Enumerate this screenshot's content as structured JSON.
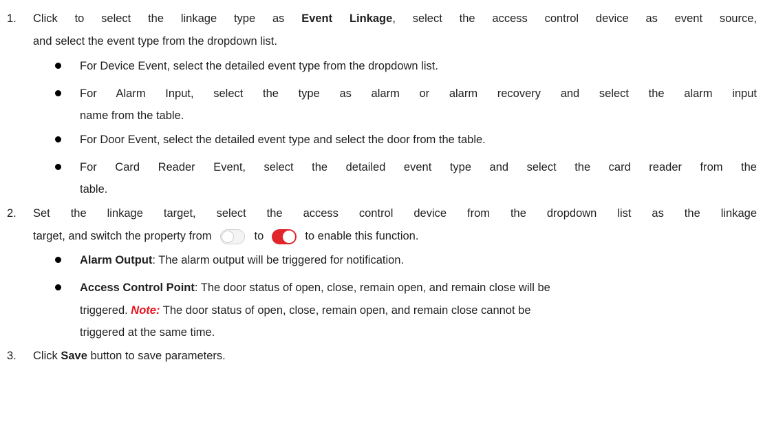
{
  "steps": [
    {
      "number": "1.",
      "lines": [
        {
          "pre": "Click to select the linkage type as ",
          "bold": "Event Linkage",
          "post": ", select the access control device as event source,"
        },
        {
          "text": "and select the event type from the dropdown list."
        }
      ],
      "bullets": [
        {
          "lines": [
            "For Device Event, select the detailed event type from the dropdown list."
          ]
        },
        {
          "lines": [
            "For Alarm Input, select the type as alarm or alarm recovery and select the alarm input",
            "name from the table."
          ]
        },
        {
          "lines": [
            "For Door Event, select the detailed event type and select the door from the table."
          ]
        },
        {
          "lines": [
            "For Card Reader Event, select the detailed event type and select the card reader from the",
            "table."
          ]
        }
      ]
    },
    {
      "number": "2.",
      "lines": [
        {
          "text": "Set the linkage target, select the access control device from the dropdown list as the linkage"
        },
        {
          "pre": "target, and switch the property from",
          "mid": "to",
          "post": "to enable this function."
        }
      ],
      "toggles": {
        "off_icon": "toggle-off-icon",
        "on_icon": "toggle-on-icon",
        "on_color": "#e0262c"
      },
      "bullets": [
        {
          "bold": "Alarm Output",
          "post": ": The alarm output will be triggered for notification."
        },
        {
          "bold": "Access Control Point",
          "post": ": The door status of open, close, remain open, and remain close will be",
          "line2_pre": "triggered. ",
          "note": "Note:",
          "line2_post": " The door status of open, close, remain open, and remain close cannot be",
          "line3": "triggered at the same time."
        }
      ]
    },
    {
      "number": "3.",
      "pre": "Click ",
      "bold": "Save",
      "post": " button to save parameters."
    }
  ],
  "colors": {
    "note": "#e8131f",
    "text": "#1f1f1f"
  }
}
